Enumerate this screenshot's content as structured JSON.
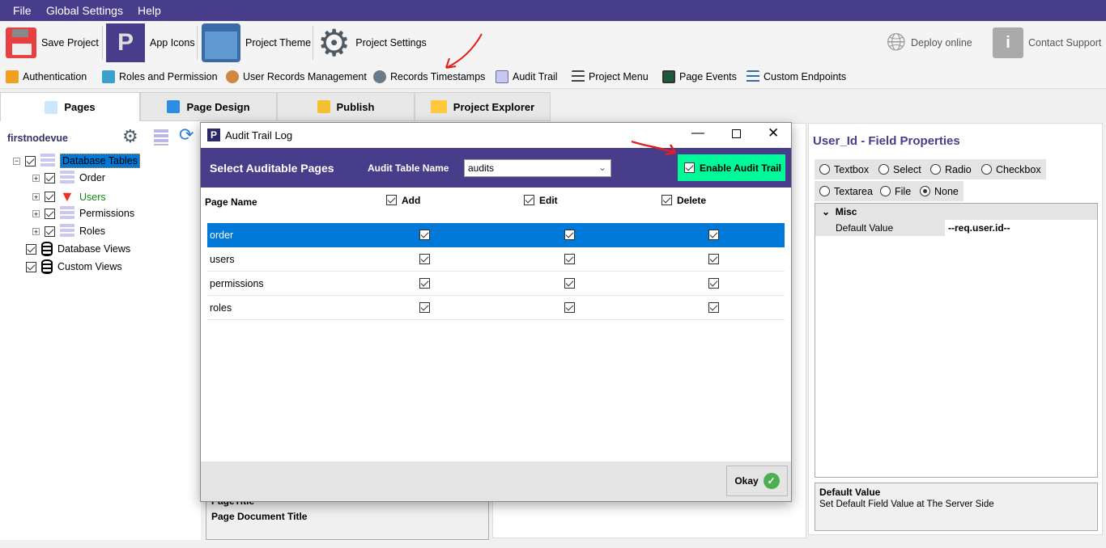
{
  "menu": {
    "items": [
      "File",
      "Global Settings",
      "Help"
    ]
  },
  "toolbar": {
    "save": "Save Project",
    "app_icons": "App Icons",
    "theme": "Project Theme",
    "settings": "Project Settings",
    "deploy": "Deploy online",
    "support": "Contact Support"
  },
  "toolbar2": {
    "items": [
      "Authentication",
      "Roles and Permission",
      "User Records Management",
      "Records Timestamps",
      "Audit Trail",
      "Project Menu",
      "Page Events",
      "Custom Endpoints"
    ]
  },
  "tabs": [
    "Pages",
    "Page Design",
    "Publish",
    "Project Explorer"
  ],
  "left": {
    "project": "firstnodevue",
    "tree": {
      "root": "Database Tables",
      "tables": [
        "Order",
        "Users",
        "Permissions",
        "Roles"
      ],
      "views": "Database Views",
      "custom": "Custom Views"
    }
  },
  "dialog": {
    "title": "Audit Trail Log",
    "header": "Select Auditable Pages",
    "table_name_label": "Audit Table Name",
    "table_name_value": "audits",
    "enable_label": "Enable Audit Trail",
    "enable_checked": true,
    "columns": {
      "name": "Page Name",
      "add": "Add",
      "edit": "Edit",
      "delete": "Delete"
    },
    "rows": [
      {
        "name": "order",
        "add": true,
        "edit": true,
        "delete": true,
        "selected": true
      },
      {
        "name": "users",
        "add": true,
        "edit": true,
        "delete": true
      },
      {
        "name": "permissions",
        "add": true,
        "edit": true,
        "delete": true
      },
      {
        "name": "roles",
        "add": true,
        "edit": true,
        "delete": true
      }
    ],
    "okay": "Okay"
  },
  "middle": {
    "page_title": "PageTitle",
    "page_doc_title": "Page Document Title"
  },
  "right": {
    "title": "User_Id - Field Properties",
    "types": [
      "Textbox",
      "Select",
      "Radio",
      "Checkbox",
      "Textarea",
      "File",
      "None"
    ],
    "selected_type": "None",
    "misc": "Misc",
    "prop_name": "Default Value",
    "prop_value": "--req.user.id--",
    "desc_title": "Default Value",
    "desc_text": "Set Default Field Value at The Server Side"
  },
  "colors": {
    "brand": "#483d8b",
    "selected": "#0078d7",
    "enable_bg": "#00fa9a"
  }
}
